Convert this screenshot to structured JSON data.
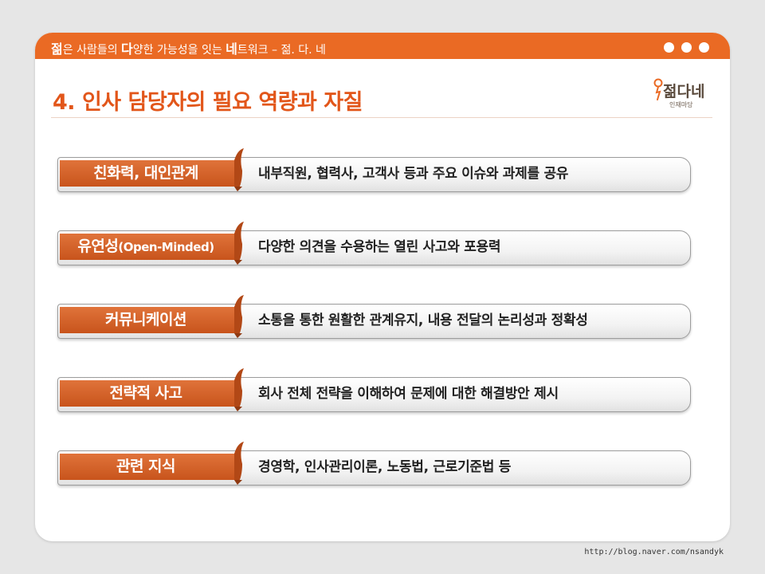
{
  "header": {
    "tagline_parts": [
      "젊",
      "은 사람들의 ",
      "다",
      "양한 가능성을 잇는 ",
      "네",
      "트워크 – 젊. 다. 네"
    ]
  },
  "title": "4. 인사 담당자의 필요 역량과 자질",
  "logo": {
    "main": "젊다네",
    "sub": "인재마당",
    "icon": "microphone-icon"
  },
  "colors": {
    "accent": "#ea6a24",
    "title": "#e2561a",
    "ribbon": "#d9652a"
  },
  "rows": [
    {
      "label": "친화력, 대인관계",
      "desc": "내부직원, 협력사, 고객사 등과 주요 이슈와 과제를 공유"
    },
    {
      "label_main": "유연성",
      "label_sub": "(Open-Minded)",
      "desc": "다양한 의견을 수용하는 열린 사고와 포용력"
    },
    {
      "label": "커뮤니케이션",
      "desc": "소통을 통한 원활한 관계유지, 내용 전달의 논리성과 정확성"
    },
    {
      "label": "전략적 사고",
      "desc": "회사 전체 전략을 이해하여 문제에 대한 해결방안 제시"
    },
    {
      "label": "관련 지식",
      "desc": "경영학, 인사관리이론, 노동법, 근로기준법 등"
    }
  ],
  "footer": {
    "url": "http://blog.naver.com/nsandyk"
  }
}
